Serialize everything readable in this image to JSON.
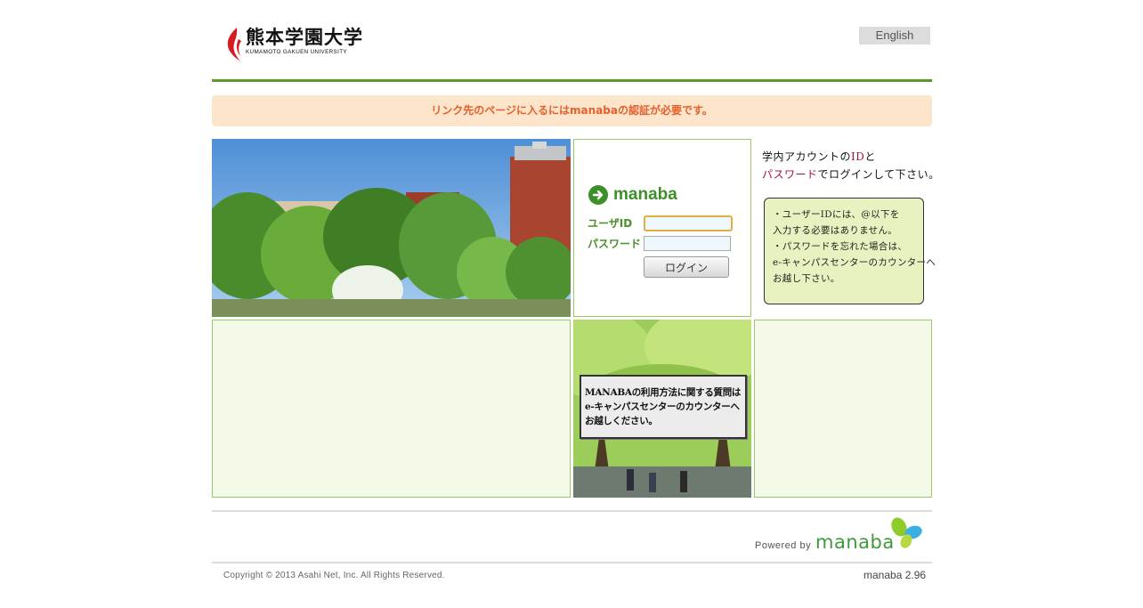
{
  "header": {
    "logo_text_jp": "熊本学園大学",
    "logo_text_en": "KUMAMOTO GAKUEN UNIVERSITY",
    "language_button": "English"
  },
  "notice": "リンク先のページに入るにはmanabaの認証が必要です。",
  "login": {
    "brand": "manaba",
    "user_label": "ユーザID",
    "pass_label": "パスワード",
    "user_value": "",
    "pass_value": "",
    "button": "ログイン"
  },
  "note": {
    "line1_a": "学内アカウントの",
    "line1_b": "ID",
    "line1_c": "と",
    "line2_a": "パスワード",
    "line2_b": "でログインして下さい。",
    "box_lines": [
      "・ユーザーIDには、@以下を",
      "  入力する必要はありません。",
      "・パスワードを忘れた場合は、",
      "  e-キャンパスセンターのカウンターへ",
      "  お越し下さい。"
    ]
  },
  "banner": {
    "lines": [
      "MANABAの利用方法に関する質問は",
      "e-キャンパスセンターのカウンターへ",
      "お越しください。"
    ]
  },
  "footer": {
    "powered_by": "Powered by",
    "powered_logo": "manaba",
    "copyright": "Copyright © 2013 Asahi Net, Inc. All Rights Reserved.",
    "version": "manaba 2.96"
  },
  "colors": {
    "brand_green": "#3c8f2a",
    "rule_green": "#5a9a2a",
    "notice_bg": "#fde5cc",
    "notice_text": "#e55f2a",
    "panel_bg": "#f3fbe8",
    "note_red": "#a5123b"
  }
}
